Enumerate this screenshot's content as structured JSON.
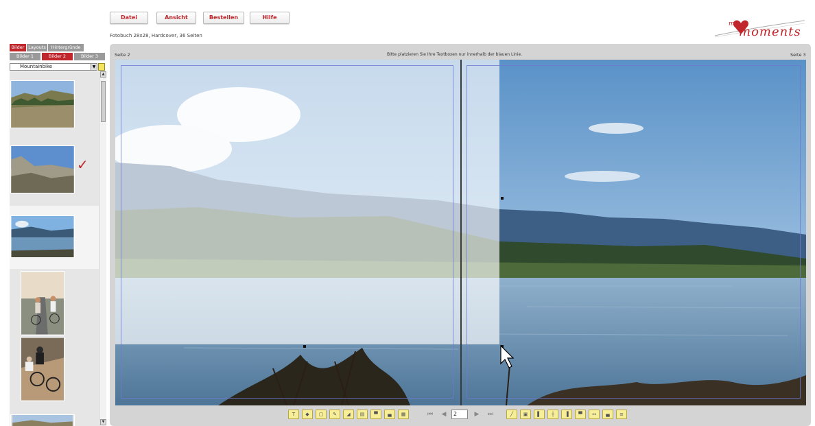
{
  "menu": {
    "file": "Datei",
    "view": "Ansicht",
    "order": "Bestellen",
    "help": "Hilfe"
  },
  "product": "Fotobuch 28x28, Hardcover, 36 Seiten",
  "logo": {
    "prefix": "my",
    "text": "moments",
    "heart_color": "#c0262c"
  },
  "tabs_main": [
    "Bilder",
    "Layouts",
    "Hintergründe"
  ],
  "tabs_images": [
    "Bilder 1",
    "Bilder 2",
    "Bilder 3"
  ],
  "folder_select": {
    "selected": "Mountainbike"
  },
  "thumbnail_selected_mark": "✓",
  "editor": {
    "left_page": "Seite 2",
    "right_page": "Seite 3",
    "hint": "Bitte platzieren Sie Ihre Textboxen nur innerhalb der blauen Linie."
  },
  "pager": {
    "current_page": "2"
  },
  "colors": {
    "accent": "#c0262c",
    "tab_active": "#c0262c",
    "tab_inactive": "#9a9a9a",
    "workspace": "#d4d4d4",
    "toolbar_button": "#f7ee9a"
  }
}
